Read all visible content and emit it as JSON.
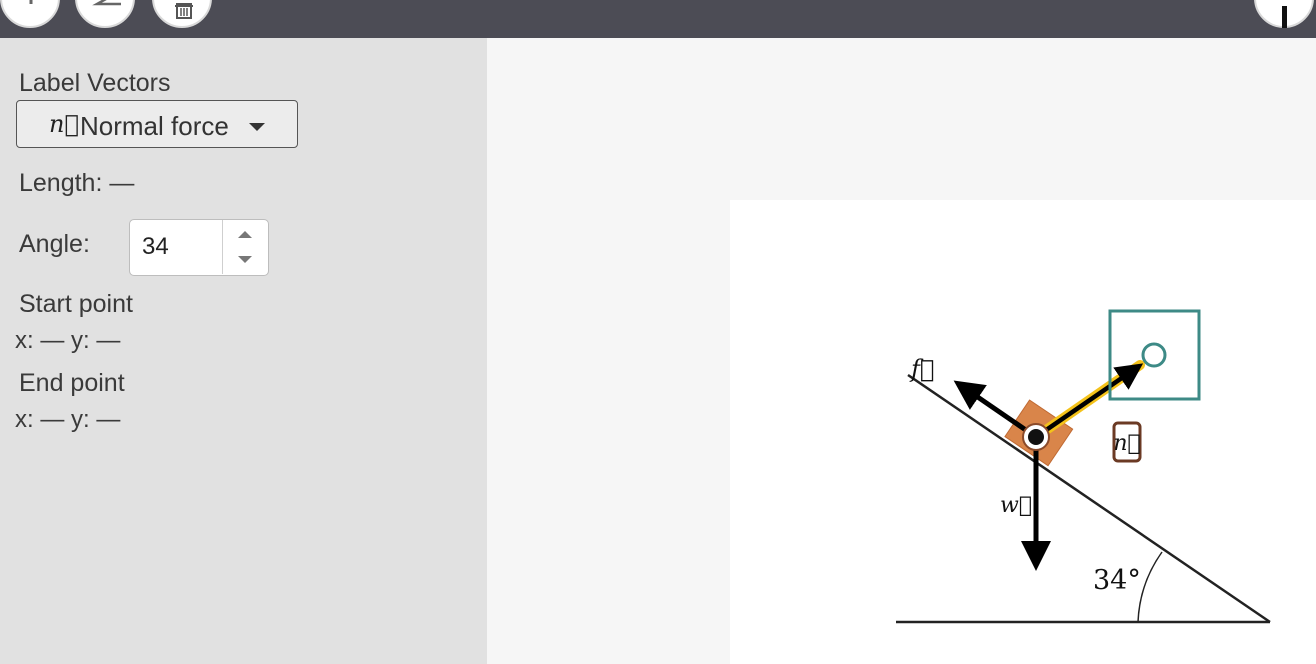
{
  "toolbar": {
    "buttons": [
      {
        "name": "add-vector-button",
        "icon": "plus-icon"
      },
      {
        "name": "angle-tool-button",
        "icon": "angle-icon"
      },
      {
        "name": "delete-button",
        "icon": "trash-icon"
      }
    ],
    "help_icon": "info-icon"
  },
  "sidebar": {
    "label_vectors": "Label Vectors",
    "selected_vector_symbol": "n⃗",
    "selected_vector_name": "Normal force",
    "length_label": "Length:",
    "length_value": "—",
    "angle_label": "Angle:",
    "angle_value": "34",
    "start_point_label": "Start point",
    "start_point_coords": "x: — y: —",
    "end_point_label": "End point",
    "end_point_coords": "x: — y: —"
  },
  "diagram": {
    "labels": {
      "friction": "f⃗",
      "weight": "w⃗",
      "normal": "n⃗",
      "angle": "34°"
    },
    "incline_angle_deg": 34,
    "colors": {
      "selected_vector_glow": "#f4c21a",
      "target_box": "#3d8a86",
      "label_box": "#6b3a24",
      "block": "#d9854a",
      "vector": "#000000"
    }
  }
}
